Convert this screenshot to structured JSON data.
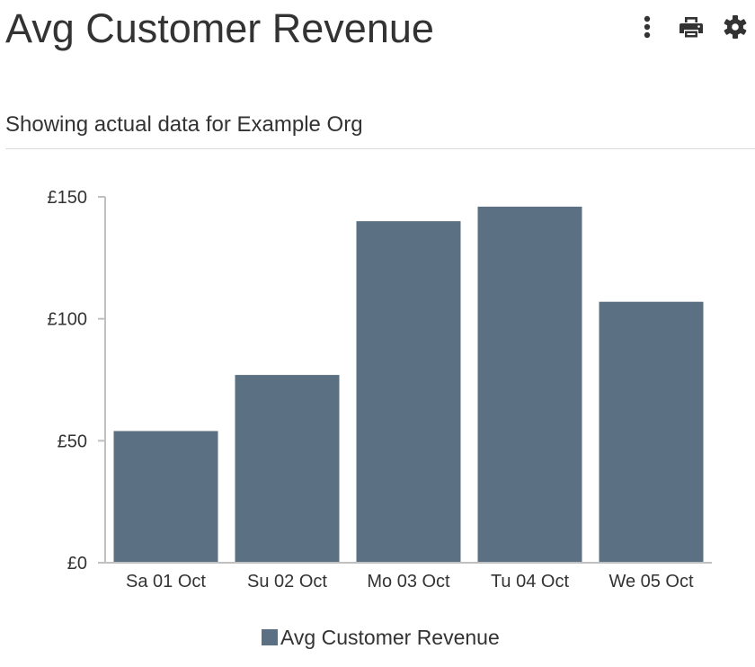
{
  "header": {
    "title": "Avg Customer Revenue",
    "subtitle": "Showing actual data for Example Org",
    "actions": [
      {
        "name": "more-options",
        "icon": "vertical-ellipsis-icon"
      },
      {
        "name": "print",
        "icon": "printer-icon"
      },
      {
        "name": "settings",
        "icon": "gear-icon"
      }
    ]
  },
  "colors": {
    "bar": "#5b7083",
    "axis": "#c0c0c0",
    "text": "#333333"
  },
  "chart_data": {
    "type": "bar",
    "categories": [
      "Sa 01 Oct",
      "Su 02 Oct",
      "Mo 03 Oct",
      "Tu 04 Oct",
      "We 05 Oct"
    ],
    "series": [
      {
        "name": "Avg Customer Revenue",
        "values": [
          54,
          77,
          140,
          146,
          107
        ]
      }
    ],
    "y_ticks": [
      "£0",
      "£50",
      "£100",
      "£150"
    ],
    "y_tick_values": [
      0,
      50,
      100,
      150
    ],
    "ylim": [
      0,
      150
    ],
    "xlabel": "",
    "ylabel": "",
    "grid": false,
    "legend_position": "bottom"
  }
}
